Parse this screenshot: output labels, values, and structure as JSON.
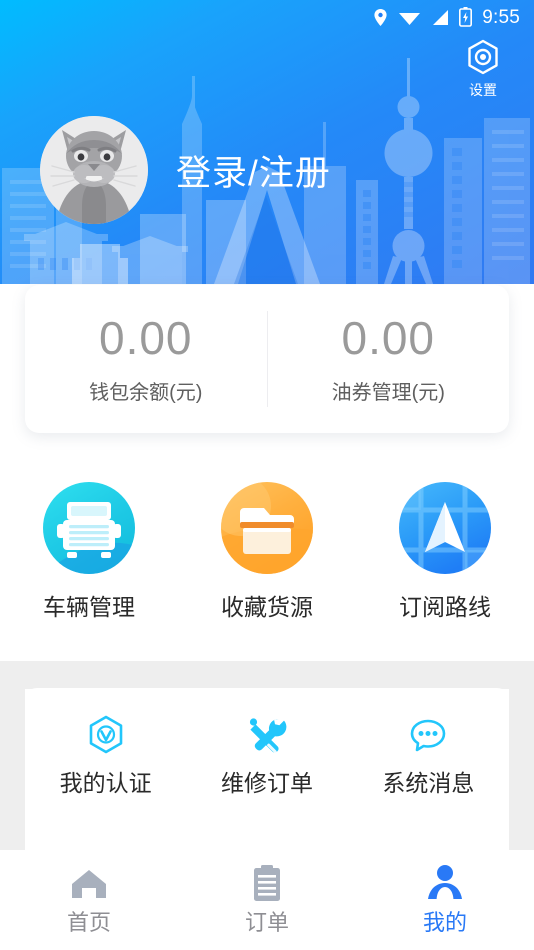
{
  "theme": {
    "header_blue_start": "#00b8ff",
    "header_blue_end": "#2f80f4",
    "accent_blue": "#2979f6",
    "accent_cyan": "#22c6fb",
    "icon_gray": "#a8b0bd",
    "value_gray": "#9a9a9a",
    "band_gray": "#eeeeee"
  },
  "statusbar": {
    "icons": [
      "location-pin-icon",
      "wifi-icon",
      "signal-icon",
      "battery-icon"
    ],
    "time": "9:55"
  },
  "header": {
    "settings": {
      "label": "设置",
      "icon": "gear-hexagon-icon"
    },
    "avatar": {
      "icon": "cat-avatar"
    },
    "login_label": "登录/注册"
  },
  "wallet": {
    "cells": [
      {
        "value": "0.00",
        "label": "钱包余额(元)"
      },
      {
        "value": "0.00",
        "label": "油券管理(元)"
      }
    ]
  },
  "shortcuts": [
    {
      "label": "车辆管理",
      "icon": "truck-icon",
      "color": "#21cde0"
    },
    {
      "label": "收藏货源",
      "icon": "folder-icon",
      "color": "#ffab33"
    },
    {
      "label": "订阅路线",
      "icon": "navigation-arrow-icon",
      "color": "#2f9cf7"
    }
  ],
  "features": [
    {
      "label": "我的认证",
      "icon": "certification-hexagon-icon"
    },
    {
      "label": "维修订单",
      "icon": "wrench-screwdriver-icon"
    },
    {
      "label": "系统消息",
      "icon": "chat-bubble-icon"
    }
  ],
  "tabs": [
    {
      "label": "首页",
      "icon": "home-icon",
      "active": false
    },
    {
      "label": "订单",
      "icon": "clipboard-icon",
      "active": false
    },
    {
      "label": "我的",
      "icon": "person-icon",
      "active": true
    }
  ]
}
